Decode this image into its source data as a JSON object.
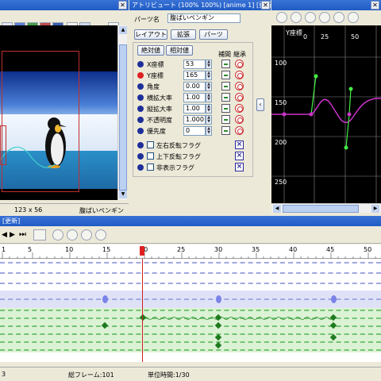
{
  "preview": {
    "title": "",
    "size": "123 x 56",
    "part_name": "腹ばいペンギン"
  },
  "attribute": {
    "title": "アトリビュート (100% 100%) [anime 1] [更新]",
    "part_name_label": "パーツ名",
    "part_name_value": "腹ばいペンギン",
    "tabs": [
      "レイアウト",
      "拡張",
      "パーツ"
    ],
    "mode_buttons": [
      "絶対値",
      "相対値"
    ],
    "col_interp": "補間",
    "col_inherit": "継承",
    "props": [
      {
        "label": "X座標",
        "value": "53"
      },
      {
        "label": "Y座標",
        "value": "165"
      },
      {
        "label": "角度",
        "value": "0.00"
      },
      {
        "label": "横拡大率",
        "value": "1.00"
      },
      {
        "label": "縦拡大率",
        "value": "1.00"
      },
      {
        "label": "不透明度",
        "value": "1.000"
      },
      {
        "label": "優先度",
        "value": "0"
      }
    ],
    "flags": [
      "左右反転フラグ",
      "上下反転フラグ",
      "非表示フラグ"
    ]
  },
  "graph": {
    "axis_label": "Y座標",
    "x_ticks": [
      "0",
      "25",
      "50"
    ],
    "y_ticks": [
      "100",
      "150",
      "200",
      "250"
    ]
  },
  "timeline": {
    "title": "[更新]",
    "ruler": [
      "1",
      "5",
      "10",
      "15",
      "20",
      "25",
      "30",
      "35",
      "40",
      "45",
      "50"
    ]
  },
  "status": {
    "frame": "3",
    "total_frames": "総フレーム:101",
    "unit_time": "単位時間:1/30"
  },
  "colors": {
    "titlebar": "#2a63cc",
    "graph_bg": "#000000",
    "curve": "#cc33cc",
    "keyframe": "#44ee44"
  }
}
